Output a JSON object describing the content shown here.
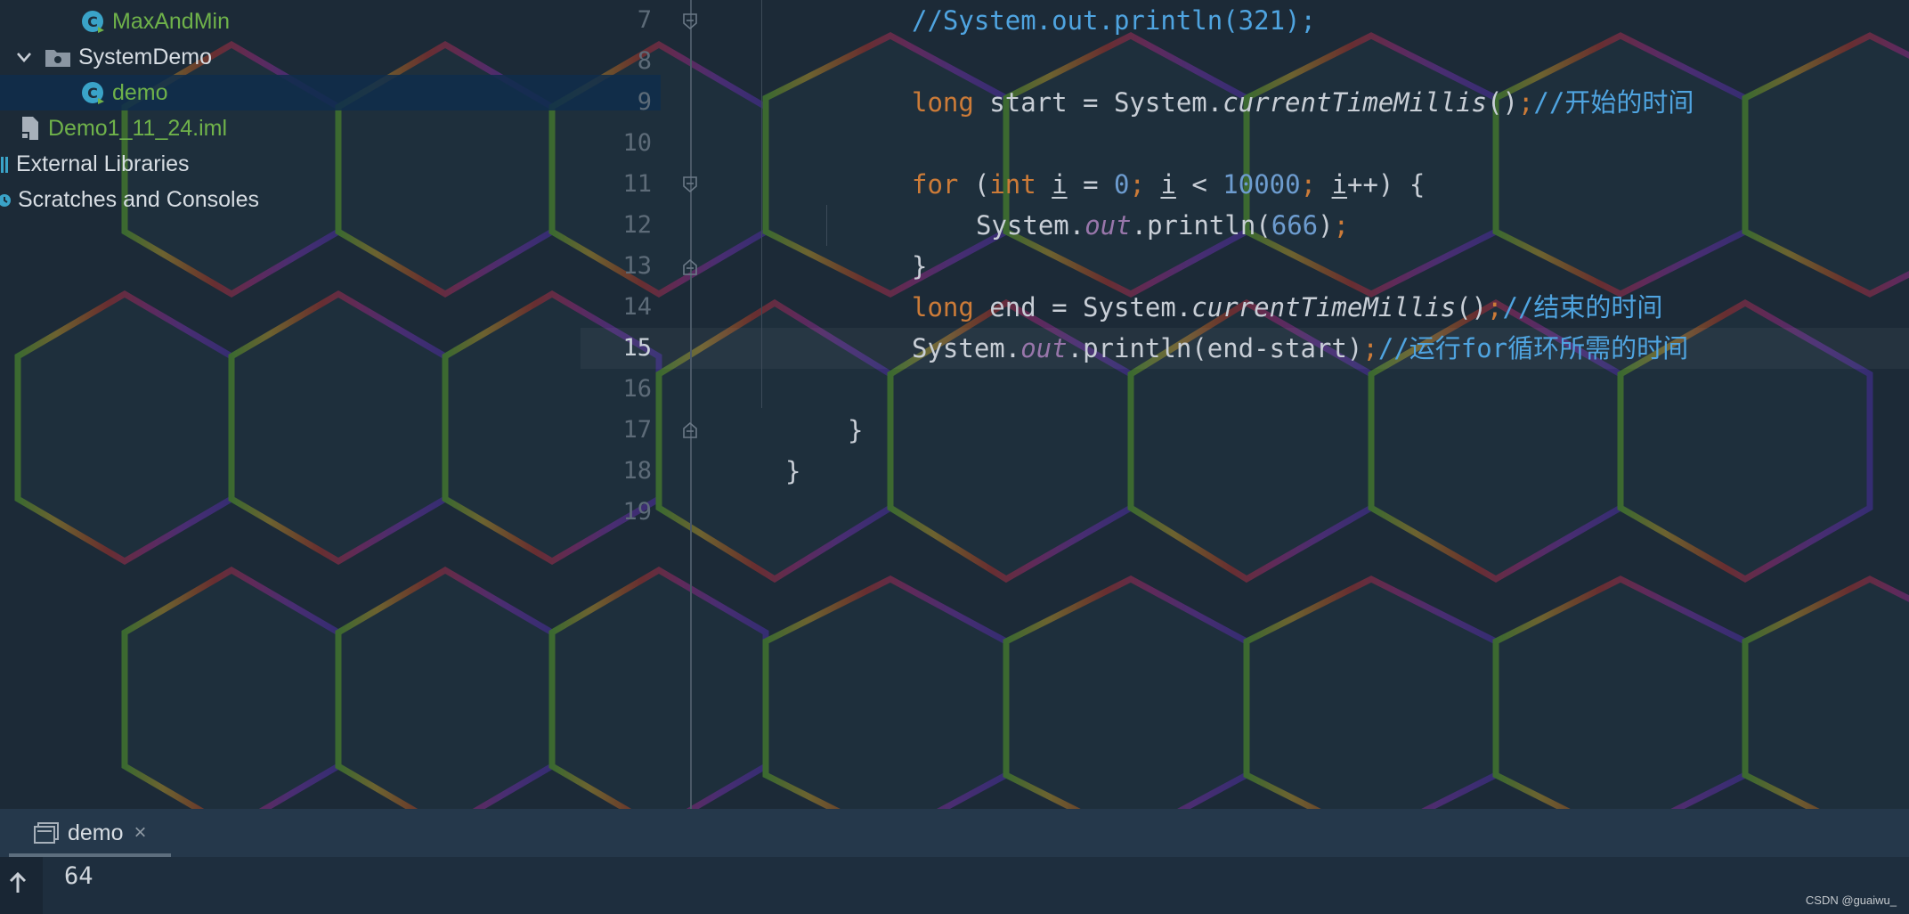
{
  "project_tree": {
    "items": [
      {
        "label": "MaxAndMin"
      },
      {
        "label": "SystemDemo"
      },
      {
        "label": "demo"
      },
      {
        "label": "Demo1_11_24.iml"
      },
      {
        "label": "External Libraries"
      },
      {
        "label": "Scratches and Consoles"
      }
    ]
  },
  "editor": {
    "current_line": 15,
    "lines": [
      {
        "number": "7",
        "tokens": [
          {
            "t": "//System.out.println(321);",
            "c": "cmt"
          }
        ]
      },
      {
        "number": "8",
        "tokens": []
      },
      {
        "number": "9",
        "tokens": [
          {
            "t": "long",
            "c": "kw"
          },
          {
            "t": " start = System."
          },
          {
            "t": "currentTimeMillis",
            "c": "static"
          },
          {
            "t": "()"
          },
          {
            "t": ";",
            "c": "semi"
          },
          {
            "t": "//开始的时间",
            "c": "cmt"
          }
        ]
      },
      {
        "number": "10",
        "tokens": []
      },
      {
        "number": "11",
        "tokens": [
          {
            "t": "for",
            "c": "kw"
          },
          {
            "t": " ("
          },
          {
            "t": "int",
            "c": "kw"
          },
          {
            "t": " "
          },
          {
            "t": "i",
            "c": "ul"
          },
          {
            "t": " = "
          },
          {
            "t": "0",
            "c": "num"
          },
          {
            "t": ";",
            "c": "semi"
          },
          {
            "t": " "
          },
          {
            "t": "i",
            "c": "ul"
          },
          {
            "t": " < "
          },
          {
            "t": "10000",
            "c": "num"
          },
          {
            "t": ";",
            "c": "semi"
          },
          {
            "t": " "
          },
          {
            "t": "i",
            "c": "ul"
          },
          {
            "t": "++) {"
          }
        ]
      },
      {
        "number": "12",
        "tokens": [
          {
            "t": "System."
          },
          {
            "t": "out",
            "c": "field"
          },
          {
            "t": ".println("
          },
          {
            "t": "666",
            "c": "num"
          },
          {
            "t": ")"
          },
          {
            "t": ";",
            "c": "semi"
          }
        ]
      },
      {
        "number": "13",
        "tokens": [
          {
            "t": "}"
          }
        ]
      },
      {
        "number": "14",
        "tokens": [
          {
            "t": "long",
            "c": "kw"
          },
          {
            "t": " end = System."
          },
          {
            "t": "currentTimeMillis",
            "c": "static"
          },
          {
            "t": "()"
          },
          {
            "t": ";",
            "c": "semi"
          },
          {
            "t": "//结束的时间",
            "c": "cmt"
          }
        ]
      },
      {
        "number": "15",
        "tokens": [
          {
            "t": "System."
          },
          {
            "t": "out",
            "c": "field"
          },
          {
            "t": ".println(end-start)"
          },
          {
            "t": ";",
            "c": "semi"
          },
          {
            "t": "//运行for循环所需的时间",
            "c": "cmt"
          }
        ]
      },
      {
        "number": "16",
        "tokens": []
      },
      {
        "number": "17",
        "tokens": [
          {
            "t": "}"
          }
        ]
      },
      {
        "number": "18",
        "tokens": [
          {
            "t": "}"
          }
        ]
      },
      {
        "number": "19",
        "tokens": []
      }
    ]
  },
  "run_panel": {
    "tab_label": "demo",
    "close_glyph": "×",
    "output": "64"
  },
  "watermark": "CSDN @guaiwu_",
  "colors": {
    "keyword": "#cc7b38",
    "number": "#6d9ccf",
    "comment": "#4fa4e0",
    "field": "#9876aa",
    "tree_green": "#6fb24a",
    "class_icon": "#3aa3c8"
  }
}
